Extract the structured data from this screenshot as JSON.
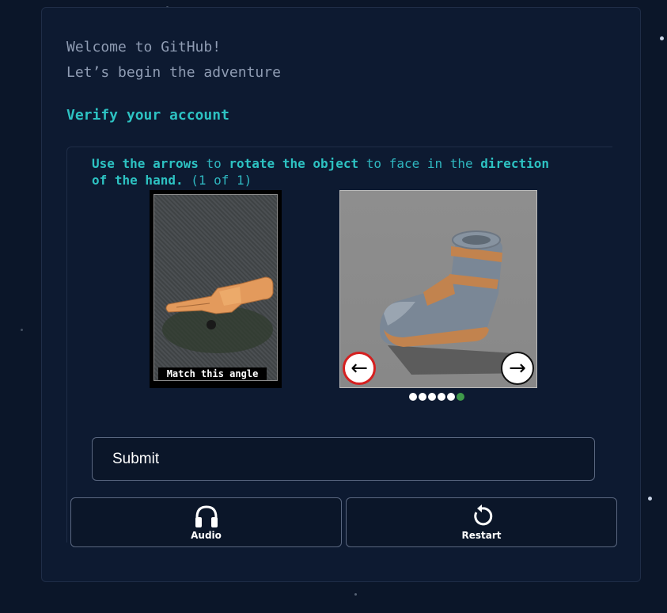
{
  "welcome": {
    "line1": "Welcome to GitHub!",
    "line2": "Let’s begin the adventure"
  },
  "verify": {
    "title": "Verify your account"
  },
  "challenge": {
    "instruction_part1": "Use the arrows",
    "instruction_part2": " to ",
    "instruction_part3": "rotate the object",
    "instruction_part4": " to face in the ",
    "instruction_part5": "direction of the hand.",
    "instruction_part6": " (1 of 1)",
    "reference_caption": "Match this angle",
    "left_arrow_icon": "arrow-left-icon",
    "right_arrow_icon": "arrow-right-icon",
    "progress_dots_total": 6,
    "progress_dots_active_index": 5
  },
  "buttons": {
    "submit": "Submit",
    "audio": "Audio",
    "restart": "Restart"
  },
  "colors": {
    "accent": "#2dc2c2",
    "background": "#0b1629",
    "card": "#0d1a31",
    "left_arrow_ring": "#d52020",
    "active_dot": "#3f9a4a"
  }
}
